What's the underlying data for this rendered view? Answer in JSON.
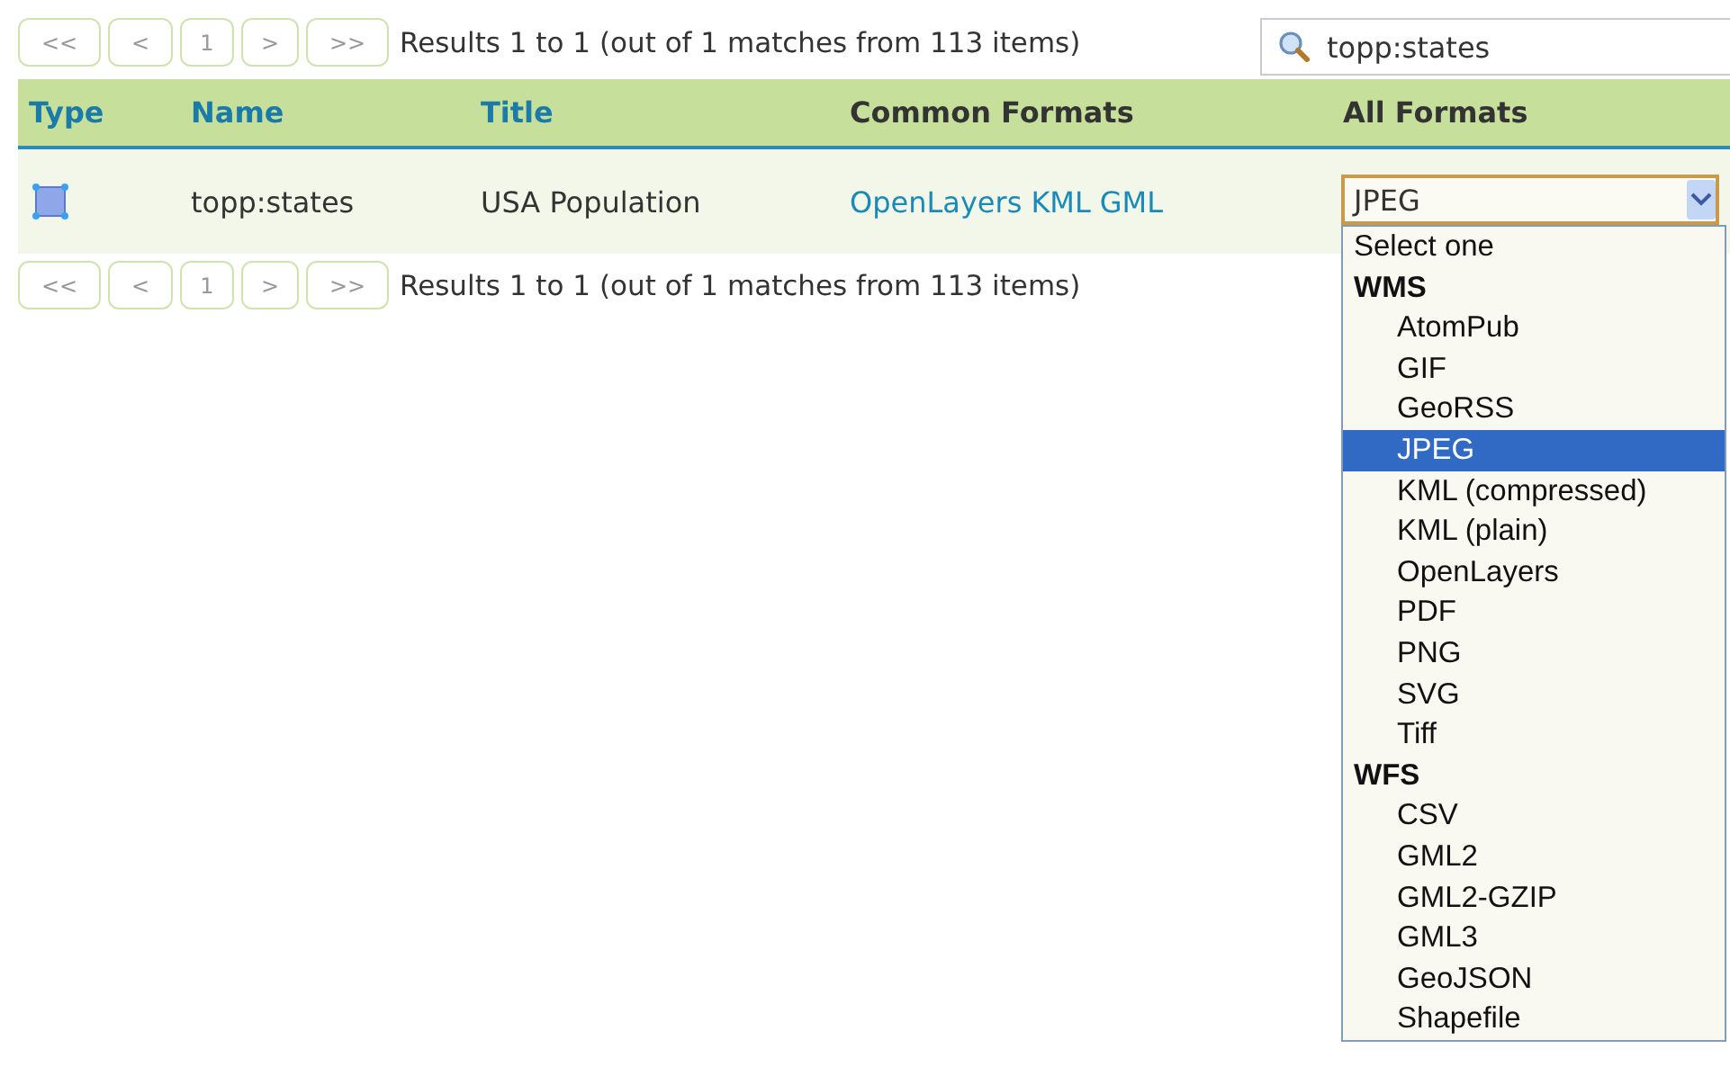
{
  "pager_top": {
    "buttons": [
      {
        "label": "<<",
        "disabled": true
      },
      {
        "label": "<",
        "disabled": true
      },
      {
        "label": "1",
        "disabled": true
      },
      {
        "label": ">",
        "disabled": true
      },
      {
        "label": ">>",
        "disabled": true
      }
    ],
    "summary": "Results 1 to 1 (out of 1 matches from 113 items)"
  },
  "search": {
    "value": "topp:states"
  },
  "table": {
    "columns": [
      "Type",
      "Name",
      "Title",
      "Common Formats",
      "All Formats"
    ],
    "rows": [
      {
        "kind": "polygon",
        "name": "topp:states",
        "title": "USA Population",
        "common_formats": [
          "OpenLayers",
          "KML",
          "GML"
        ],
        "all_formats": {
          "value": "JPEG",
          "expanded": true,
          "options": [
            {
              "kind": "option",
              "label": "Select one",
              "selected": false
            },
            {
              "kind": "group",
              "label": "WMS"
            },
            {
              "kind": "option",
              "label": "AtomPub",
              "selected": false
            },
            {
              "kind": "option",
              "label": "GIF",
              "selected": false
            },
            {
              "kind": "option",
              "label": "GeoRSS",
              "selected": false
            },
            {
              "kind": "option",
              "label": "JPEG",
              "selected": true
            },
            {
              "kind": "option",
              "label": "KML (compressed)",
              "selected": false
            },
            {
              "kind": "option",
              "label": "KML (plain)",
              "selected": false
            },
            {
              "kind": "option",
              "label": "OpenLayers",
              "selected": false
            },
            {
              "kind": "option",
              "label": "PDF",
              "selected": false
            },
            {
              "kind": "option",
              "label": "PNG",
              "selected": false
            },
            {
              "kind": "option",
              "label": "SVG",
              "selected": false
            },
            {
              "kind": "option",
              "label": "Tiff",
              "selected": false
            },
            {
              "kind": "group",
              "label": "WFS"
            },
            {
              "kind": "option",
              "label": "CSV",
              "selected": false
            },
            {
              "kind": "option",
              "label": "GML2",
              "selected": false
            },
            {
              "kind": "option",
              "label": "GML2-GZIP",
              "selected": false
            },
            {
              "kind": "option",
              "label": "GML3",
              "selected": false
            },
            {
              "kind": "option",
              "label": "GeoJSON",
              "selected": false
            },
            {
              "kind": "option",
              "label": "Shapefile",
              "selected": false
            }
          ]
        }
      }
    ]
  },
  "pager_bottom": {
    "buttons": [
      {
        "label": "<<",
        "disabled": true
      },
      {
        "label": "<",
        "disabled": true
      },
      {
        "label": "1",
        "disabled": true
      },
      {
        "label": ">",
        "disabled": true
      },
      {
        "label": ">>",
        "disabled": true
      }
    ],
    "summary": "Results 1 to 1 (out of 1 matches from 113 items)"
  }
}
